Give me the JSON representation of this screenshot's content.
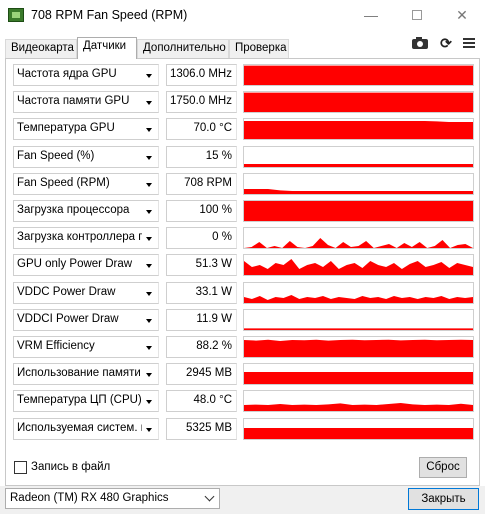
{
  "window": {
    "title": "708 RPM Fan Speed (RPM)",
    "minimize_glyph": "—",
    "close_glyph": "✕"
  },
  "tabs": [
    {
      "label": "Видеокарта",
      "active": false
    },
    {
      "label": "Датчики",
      "active": true
    },
    {
      "label": "Дополнительно",
      "active": false
    },
    {
      "label": "Проверка",
      "active": false
    }
  ],
  "toolbar": {
    "icons": [
      "camera-icon",
      "refresh-icon",
      "menu-icon"
    ],
    "refresh_glyph": "⟳"
  },
  "sensor_color": "#ff0000",
  "sensors": [
    {
      "name": "Частота ядра GPU",
      "value": "1306.0 MHz",
      "graph": [
        0.97
      ]
    },
    {
      "name": "Частота памяти GPU",
      "value": "1750.0 MHz",
      "graph": [
        0.97
      ]
    },
    {
      "name": "Температура GPU",
      "value": "70.0 °C",
      "graph": [
        0.9,
        0.9,
        0.9,
        0.9,
        0.9,
        0.9,
        0.9,
        0.9,
        0.9,
        0.9,
        0.9,
        0.9,
        0.9,
        0.9,
        0.9,
        0.9,
        0.88,
        0.85,
        0.85,
        0.85
      ]
    },
    {
      "name": "Fan Speed (%)",
      "value": "15 %",
      "graph": [
        0.15
      ]
    },
    {
      "name": "Fan Speed (RPM)",
      "value": "708 RPM",
      "graph": [
        0.25,
        0.25,
        0.25,
        0.18,
        0.15,
        0.15,
        0.15,
        0.15,
        0.15,
        0.15,
        0.15,
        0.15,
        0.15,
        0.15,
        0.15,
        0.15,
        0.15,
        0.15,
        0.15,
        0.15
      ]
    },
    {
      "name": "Загрузка процессора",
      "value": "100 %",
      "graph": [
        1.0
      ]
    },
    {
      "name": "Загрузка контроллера па...",
      "value": "0 %",
      "graph": [
        0,
        0.05,
        0.3,
        0,
        0.1,
        0,
        0.35,
        0.05,
        0,
        0.1,
        0.5,
        0.15,
        0,
        0.3,
        0.05,
        0.1,
        0.35,
        0,
        0.1,
        0.2,
        0,
        0.25,
        0.05,
        0.3,
        0,
        0.1,
        0.4,
        0,
        0.15,
        0.2,
        0
      ]
    },
    {
      "name": "GPU only Power Draw",
      "value": "51.3 W",
      "graph": [
        0.7,
        0.4,
        0.5,
        0.3,
        0.6,
        0.5,
        0.8,
        0.3,
        0.5,
        0.6,
        0.4,
        0.7,
        0.3,
        0.5,
        0.6,
        0.35,
        0.7,
        0.5,
        0.4,
        0.6,
        0.3,
        0.55,
        0.7,
        0.4,
        0.5,
        0.65,
        0.35,
        0.6,
        0.5,
        0.4
      ]
    },
    {
      "name": "VDDC Power Draw",
      "value": "33.1 W",
      "graph": [
        0.3,
        0.2,
        0.35,
        0.15,
        0.3,
        0.25,
        0.4,
        0.2,
        0.3,
        0.25,
        0.35,
        0.2,
        0.3,
        0.25,
        0.2,
        0.35,
        0.25,
        0.3,
        0.2,
        0.35,
        0.25,
        0.3,
        0.2,
        0.3,
        0.25,
        0.35,
        0.2,
        0.3,
        0.25,
        0.3
      ]
    },
    {
      "name": "VDDCI Power Draw",
      "value": "11.9 W",
      "graph": [
        0.08
      ]
    },
    {
      "name": "VRM Efficiency",
      "value": "88.2 %",
      "graph": [
        0.85,
        0.82,
        0.86,
        0.8,
        0.85,
        0.84,
        0.86,
        0.82,
        0.85,
        0.86,
        0.84,
        0.85,
        0.86,
        0.83,
        0.85,
        0.86,
        0.84,
        0.85,
        0.86,
        0.85
      ]
    },
    {
      "name": "Использование памяти (вс...",
      "value": "2945 MB",
      "graph": [
        0.6
      ]
    },
    {
      "name": "Температура ЦП (CPU)",
      "value": "48.0 °C",
      "graph": [
        0.3,
        0.32,
        0.3,
        0.35,
        0.3,
        0.32,
        0.3,
        0.33,
        0.38,
        0.3,
        0.32,
        0.3,
        0.35,
        0.4,
        0.33,
        0.3,
        0.32,
        0.3,
        0.36,
        0.3
      ]
    },
    {
      "name": "Используемая систем. пам...",
      "value": "5325 MB",
      "graph": [
        0.55
      ]
    }
  ],
  "footer": {
    "log_to_file_label": "Запись в файл",
    "log_to_file_checked": false,
    "reset_label": "Сброс"
  },
  "bottom": {
    "gpu_selected": "Radeon (TM) RX 480 Graphics",
    "close_label": "Закрыть"
  }
}
